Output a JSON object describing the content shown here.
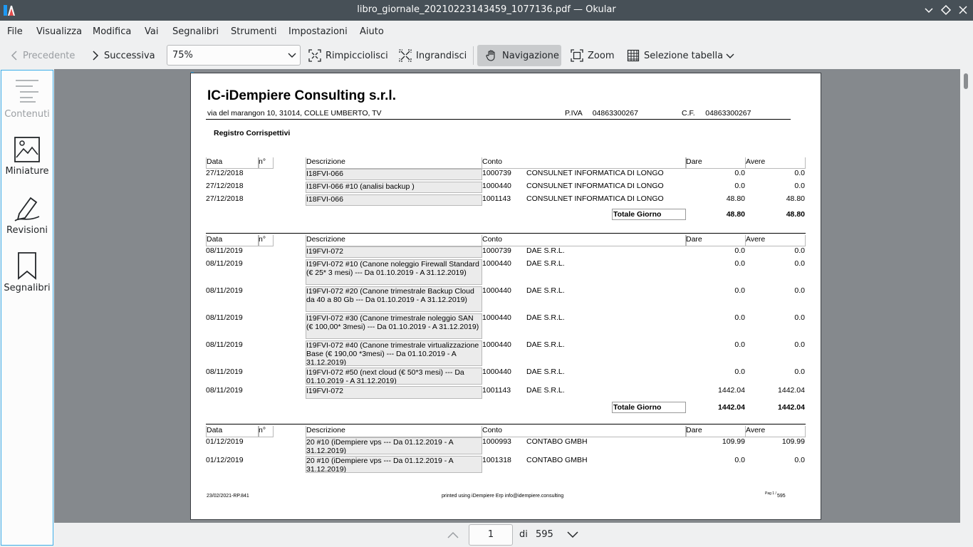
{
  "window": {
    "title": "libro_giornale_20210223143459_1077136.pdf — Okular"
  },
  "menu": [
    "File",
    "Visualizza",
    "Modifica",
    "Vai",
    "Segnalibri",
    "Strumenti",
    "Impostazioni",
    "Aiuto"
  ],
  "toolbar": {
    "prev": "Precedente",
    "next": "Successiva",
    "zoom_value": "75%",
    "zoom_out": "Rimpicciolisci",
    "zoom_in": "Ingrandisci",
    "browse": "Navigazione",
    "zoom_tool": "Zoom",
    "table_select": "Selezione tabella"
  },
  "sidebar": {
    "items": [
      {
        "label": "Contenuti",
        "icon": "contents-icon",
        "enabled": false
      },
      {
        "label": "Miniature",
        "icon": "thumbnails-icon",
        "enabled": true
      },
      {
        "label": "Revisioni",
        "icon": "annotations-icon",
        "enabled": true
      },
      {
        "label": "Segnalibri",
        "icon": "bookmarks-icon",
        "enabled": true
      }
    ]
  },
  "document": {
    "company": "IC-iDempiere Consulting s.r.l.",
    "address": "via del marangon 10, 31014, COLLE UMBERTO, TV",
    "piva": "P.IVA     04863300267",
    "cf": "C.F.     04863300267",
    "register_title": "Registro Corrispettivi",
    "headers": {
      "data": "Data",
      "n": "n°",
      "descrizione": "Descrizione",
      "conto": "Conto",
      "dare": "Dare",
      "avere": "Avere"
    },
    "total_label": "Totale Giorno",
    "groups": [
      {
        "rows": [
          {
            "date": "27/12/2018",
            "desc": "I18FVI-066",
            "account": "1000739",
            "name": "CONSULNET INFORMATICA DI LONGO",
            "dare": "0.0",
            "avere": "0.0"
          },
          {
            "date": "27/12/2018",
            "desc": "I18FVI-066 #10 (analisi backup )",
            "account": "1000440",
            "name": "CONSULNET INFORMATICA DI LONGO",
            "dare": "0.0",
            "avere": "0.0"
          },
          {
            "date": "27/12/2018",
            "desc": "I18FVI-066",
            "account": "1001143",
            "name": "CONSULNET INFORMATICA DI LONGO",
            "dare": "48.80",
            "avere": "48.80"
          }
        ],
        "total_dare": "48.80",
        "total_avere": "48.80"
      },
      {
        "rows": [
          {
            "date": "08/11/2019",
            "desc": "I19FVI-072",
            "account": "1000739",
            "name": "DAE S.R.L.",
            "dare": "0.0",
            "avere": "0.0"
          },
          {
            "date": "08/11/2019",
            "desc": "I19FVI-072 #10 (Canone noleggio Firewall Standard (€ 25* 3 mesi) --- Da 01.10.2019 - A 31.12.2019)",
            "account": "1000440",
            "name": "DAE S.R.L.",
            "dare": "0.0",
            "avere": "0.0"
          },
          {
            "date": "08/11/2019",
            "desc": "I19FVI-072 #20 (Canone trimestrale Backup Cloud da 40 a 80 Gb --- Da 01.10.2019 - A 31.12.2019)",
            "account": "1000440",
            "name": "DAE S.R.L.",
            "dare": "0.0",
            "avere": "0.0"
          },
          {
            "date": "08/11/2019",
            "desc": "I19FVI-072 #30 (Canone trimestrale noleggio SAN (€ 100,00* 3mesi) --- Da 01.10.2019 - A 31.12.2019)",
            "account": "1000440",
            "name": "DAE S.R.L.",
            "dare": "0.0",
            "avere": "0.0"
          },
          {
            "date": "08/11/2019",
            "desc": "I19FVI-072 #40 (Canone trimestrale virtualizzazione Base (€ 190,00 *3mesi) --- Da 01.10.2019 - A 31.12.2019)",
            "account": "1000440",
            "name": "DAE S.R.L.",
            "dare": "0.0",
            "avere": "0.0"
          },
          {
            "date": "08/11/2019",
            "desc": "I19FVI-072 #50 (next cloud (€ 50*3 mesi) --- Da 01.10.2019 - A 31.12.2019)",
            "account": "1000440",
            "name": "DAE S.R.L.",
            "dare": "0.0",
            "avere": "0.0"
          },
          {
            "date": "08/11/2019",
            "desc": "I19FVI-072",
            "account": "1001143",
            "name": "DAE S.R.L.",
            "dare": "1442.04",
            "avere": "1442.04"
          }
        ],
        "total_dare": "1442.04",
        "total_avere": "1442.04"
      },
      {
        "rows": [
          {
            "date": "01/12/2019",
            "desc": "20 #10 (iDempiere vps --- Da 01.12.2019 - A 31.12.2019)",
            "account": "1000993",
            "name": "CONTABO GMBH",
            "dare": "109.99",
            "avere": "109.99"
          },
          {
            "date": "01/12/2019",
            "desc": "20 #10 (iDempiere vps --- Da 01.12.2019 - A 31.12.2019)",
            "account": "1001318",
            "name": "CONTABO GMBH",
            "dare": "0.0",
            "avere": "0.0"
          }
        ]
      }
    ],
    "footer_left": "23/02/2021-RP.841",
    "footer_center": "printed using iDempiere Erp info@idempiere.consulting",
    "footer_right_small": "Pag 1 /",
    "footer_right": "595"
  },
  "pager": {
    "current": "1",
    "of_label": "di",
    "total": "595"
  }
}
